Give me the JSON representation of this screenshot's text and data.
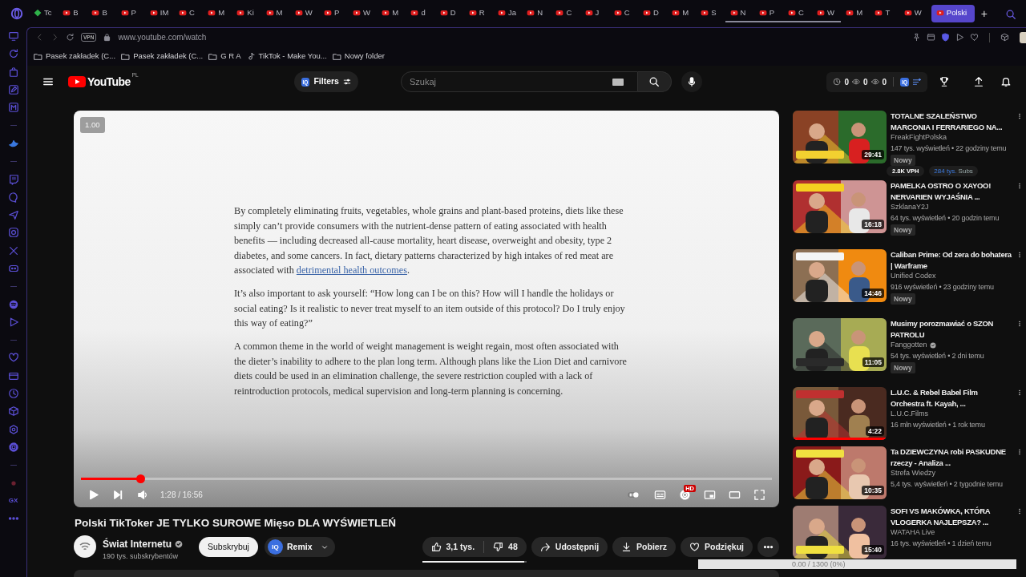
{
  "browser": {
    "tabs": [
      {
        "label": "Tc",
        "kind": "diamond",
        "selected": false,
        "grouped": false
      },
      {
        "label": "B",
        "kind": "play",
        "selected": false,
        "grouped": false
      },
      {
        "label": "B",
        "kind": "play",
        "selected": false,
        "grouped": false
      },
      {
        "label": "P",
        "kind": "play",
        "selected": false,
        "grouped": false
      },
      {
        "label": "IM",
        "kind": "play",
        "selected": false,
        "grouped": false
      },
      {
        "label": "C",
        "kind": "play",
        "selected": false,
        "grouped": false
      },
      {
        "label": "M",
        "kind": "play",
        "selected": false,
        "grouped": false
      },
      {
        "label": "Ki",
        "kind": "play",
        "selected": false,
        "grouped": false
      },
      {
        "label": "M",
        "kind": "play",
        "selected": false,
        "grouped": false
      },
      {
        "label": "W",
        "kind": "play",
        "selected": false,
        "grouped": false
      },
      {
        "label": "P",
        "kind": "play",
        "selected": false,
        "grouped": false
      },
      {
        "label": "W",
        "kind": "play",
        "selected": false,
        "grouped": false
      },
      {
        "label": "M",
        "kind": "play",
        "selected": false,
        "grouped": false
      },
      {
        "label": "d",
        "kind": "play",
        "selected": false,
        "grouped": false
      },
      {
        "label": "D",
        "kind": "play",
        "selected": false,
        "grouped": false
      },
      {
        "label": "R",
        "kind": "play",
        "selected": false,
        "grouped": false
      },
      {
        "label": "Ja",
        "kind": "play",
        "selected": false,
        "grouped": false
      },
      {
        "label": "N",
        "kind": "play",
        "selected": false,
        "grouped": false
      },
      {
        "label": "C",
        "kind": "play",
        "selected": false,
        "grouped": false
      },
      {
        "label": "J",
        "kind": "play",
        "selected": false,
        "grouped": false
      },
      {
        "label": "C",
        "kind": "play",
        "selected": false,
        "grouped": false
      },
      {
        "label": "D",
        "kind": "play",
        "selected": false,
        "grouped": false
      },
      {
        "label": "M",
        "kind": "play",
        "selected": false,
        "grouped": false
      },
      {
        "label": "S",
        "kind": "play",
        "selected": false,
        "grouped": false
      },
      {
        "label": "N",
        "kind": "play",
        "selected": false,
        "grouped": true
      },
      {
        "label": "P",
        "kind": "play",
        "selected": false,
        "grouped": true
      },
      {
        "label": "C",
        "kind": "play",
        "selected": false,
        "grouped": true
      },
      {
        "label": "W",
        "kind": "play",
        "selected": false,
        "grouped": true
      },
      {
        "label": "M",
        "kind": "play",
        "selected": false,
        "grouped": false
      },
      {
        "label": "T",
        "kind": "play",
        "selected": false,
        "grouped": false
      },
      {
        "label": "W",
        "kind": "play",
        "selected": false,
        "grouped": false
      },
      {
        "label": "Polski",
        "kind": "play",
        "selected": true,
        "grouped": false
      }
    ],
    "new_tab": "+",
    "address": {
      "vpn": "VPN",
      "url": "www.youtube.com/watch"
    },
    "bookmarks": [
      {
        "label": "Pasek zakładek (C...",
        "kind": "folder"
      },
      {
        "label": "Pasek zakładek (C...",
        "kind": "folder"
      },
      {
        "label": "G R A",
        "kind": "folder"
      },
      {
        "label": "TikTok - Make You...",
        "kind": "note"
      },
      {
        "label": "Nowy folder",
        "kind": "folder"
      }
    ],
    "sidebar_label": "GX"
  },
  "header": {
    "logo": "YouTube",
    "region": "PL",
    "filters": {
      "badge": "IQ",
      "label": "Filters"
    },
    "search": {
      "placeholder": "Szukaj"
    },
    "counters": [
      {
        "kind": "clock",
        "value": "0"
      },
      {
        "kind": "eye",
        "value": "0"
      },
      {
        "kind": "eye",
        "value": "0"
      }
    ],
    "iq_badge": "IQ"
  },
  "player": {
    "speed": "1.00",
    "article": [
      {
        "text": "By completely eliminating fruits, vegetables, whole grains and plant-based proteins, diets like these simply can’t provide consumers with the nutrient-dense pattern of eating associated with health benefits — including decreased all-cause mortality, heart disease, overweight and obesity, type 2 diabetes, and some cancers. In fact, dietary patterns characterized by high intakes of red meat are associated with ",
        "link": "detrimental health outcomes",
        "tail": "."
      },
      {
        "text": "It’s also important to ask yourself: “How long can I be on this? How will I handle the holidays or social eating? Is it realistic to never treat myself to an item outside of this protocol? Do I truly enjoy this way of eating?”"
      },
      {
        "text": "A common theme in the world of weight management is weight regain, most often associated with the dieter’s inability to adhere to the plan long term. Although plans like the Lion Diet and carnivore diets could be used in an elimination challenge, the severe restriction coupled with a lack of reintroduction protocols, medical supervision and long-term planning is concerning."
      }
    ],
    "progress": {
      "level": 0.087
    },
    "time": "1:28 / 16:56",
    "autoplay_on": false,
    "hd_badge": "HD"
  },
  "video": {
    "title": "Polski TikToker JE TYLKO SUROWE Mięso DLA WYŚWIETLEŃ",
    "channel": {
      "name": "Świat Internetu",
      "verified": true,
      "subscribers": "190 tys. subskrybentów"
    },
    "subscribe": "Subskrybuj",
    "remix": {
      "badge": "IQ",
      "label": "Remix"
    },
    "likes": "3,1 tys.",
    "dislikes": "48",
    "ratio": {
      "level": 0.98
    },
    "actions": [
      {
        "kind": "share",
        "label": "Udostępnij"
      },
      {
        "kind": "download",
        "label": "Pobierz"
      },
      {
        "kind": "thanks",
        "label": "Podziękuj"
      }
    ]
  },
  "recommendations": [
    {
      "title": "TOTALNE SZALEŃSTWO MARCONIA I FERRARIEGO NA...",
      "channel": "FreakFightPolska",
      "verified": false,
      "meta": "147 tys. wyświetleń • 22 godziny temu",
      "duration": "29:41",
      "badge": "Nowy",
      "stats": {
        "vph": "2.8K VPH",
        "subs_count": "284 tys.",
        "subs_label": "Subs"
      }
    },
    {
      "title": "PAMELKA OSTRO O XAYOO! NERVARIEN WYJAŚNIA ...",
      "channel": "SzklanaY2J",
      "verified": false,
      "meta": "64 tys. wyświetleń • 20 godzin temu",
      "duration": "16:18",
      "badge": "Nowy"
    },
    {
      "title": "Caliban Prime: Od zera do bohatera | Warframe",
      "channel": "Unified Codex",
      "verified": false,
      "meta": "916 wyświetleń • 23 godziny temu",
      "duration": "14:46",
      "badge": "Nowy"
    },
    {
      "title": "Musimy porozmawiać o SZON PATROLU",
      "channel": "Fanggotten",
      "verified": true,
      "meta": "54 tys. wyświetleń • 2 dni temu",
      "duration": "11:05",
      "badge": "Nowy"
    },
    {
      "title": "L.U.C. & Rebel Babel Film Orchestra ft. Kayah, ...",
      "channel": "L.U.C.Films",
      "verified": false,
      "meta": "16 mln wyświetleń • 1 rok temu",
      "duration": "4:22",
      "level": 1
    },
    {
      "title": "Ta DZIEWCZYNA robi PASKUDNE rzeczy - Analiza ...",
      "channel": "Strefa Wiedzy",
      "verified": false,
      "meta": "5,4 tys. wyświetleń • 2 tygodnie temu",
      "duration": "10:35"
    },
    {
      "title": "SOFI VS MAKÓWKA, KTÓRA VLOGERKA NAJLEPSZA? ...",
      "channel": "WATAHA Live",
      "verified": false,
      "meta": "16 tys. wyświetleń • 1 dzień temu",
      "duration": "15:40"
    }
  ],
  "overlay_counter": "0.00 / 1300 (0%)"
}
